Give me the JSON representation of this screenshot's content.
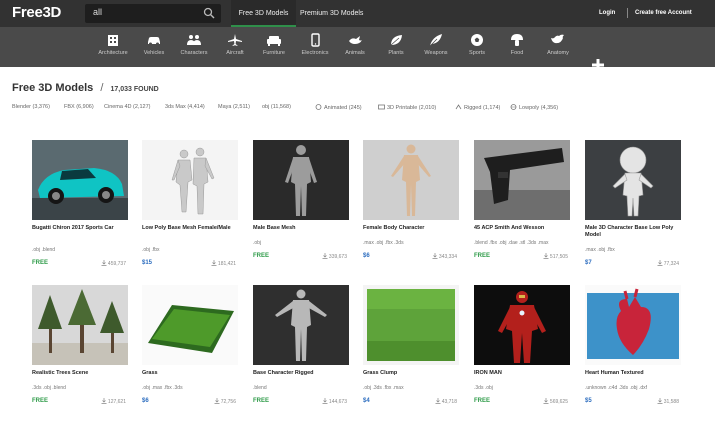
{
  "header": {
    "logo": "Free3D",
    "search_value": "all",
    "tabs": [
      "Free 3D Models",
      "Premium 3D Models"
    ],
    "login": "Login",
    "create_account": "Create free Account"
  },
  "categories": [
    {
      "label": "Architecture",
      "icon": "building-icon"
    },
    {
      "label": "Vehicles",
      "icon": "car-icon"
    },
    {
      "label": "Characters",
      "icon": "people-icon"
    },
    {
      "label": "Aircraft",
      "icon": "airplane-icon"
    },
    {
      "label": "Furniture",
      "icon": "sofa-icon"
    },
    {
      "label": "Electronics",
      "icon": "phone-icon"
    },
    {
      "label": "Animals",
      "icon": "bird-icon"
    },
    {
      "label": "Plants",
      "icon": "leaf-icon"
    },
    {
      "label": "Weapons",
      "icon": "feather-icon"
    },
    {
      "label": "Sports",
      "icon": "soccer-ball-icon"
    },
    {
      "label": "Food",
      "icon": "mushroom-icon"
    },
    {
      "label": "Anatomy",
      "icon": "bird-anatomy-icon"
    }
  ],
  "listing": {
    "title": "Free 3D Models",
    "slash": "/",
    "count": "17,033 FOUND"
  },
  "filters": [
    "Blender (3,376)",
    "FBX (6,906)",
    "Cinema 4D (2,127)",
    "3ds Max (4,414)",
    "Maya (2,511)",
    "obj (11,568)",
    "Animated (245)",
    "3D Printable (2,010)",
    "Rigged (1,174)",
    "Lowpoly (4,356)"
  ],
  "models": [
    {
      "name": "Bugatti Chiron 2017 Sports Car",
      "formats": ".obj .blend",
      "price": "FREE",
      "downloads": "459,737"
    },
    {
      "name": "Low Poly Base Mesh Female/Male",
      "formats": ".obj .fbx",
      "price": "$15",
      "downloads": "181,421"
    },
    {
      "name": "Male Base Mesh",
      "formats": ".obj",
      "price": "FREE",
      "downloads": "339,673"
    },
    {
      "name": "Female Body Character",
      "formats": ".max .obj .fbx .3ds",
      "price": "$6",
      "downloads": "343,334"
    },
    {
      "name": "45 ACP Smith And Wesson",
      "formats": ".blend .fbx .obj .dae .stl .3ds .max",
      "price": "FREE",
      "downloads": "517,505"
    },
    {
      "name": "Male 3D Character Base Low Poly Model",
      "formats": ".max .obj .fbx",
      "price": "$7",
      "downloads": "77,324"
    },
    {
      "name": "Realistic Trees Scene",
      "formats": ".3ds .obj .blend",
      "price": "FREE",
      "downloads": "127,621"
    },
    {
      "name": "Grass",
      "formats": ".obj .max .fbx .3ds",
      "price": "$6",
      "downloads": "72,756"
    },
    {
      "name": "Base Character Rigged",
      "formats": ".blend",
      "price": "FREE",
      "downloads": "144,673"
    },
    {
      "name": "Grass Clump",
      "formats": ".obj .3ds .fbx .max",
      "price": "$4",
      "downloads": "43,718"
    },
    {
      "name": "IRON MAN",
      "formats": ".3ds .obj",
      "price": "FREE",
      "downloads": "569,625"
    },
    {
      "name": "Heart Human Textured",
      "formats": ".unknown .c4d .3ds .obj .dxf",
      "price": "$5",
      "downloads": "31,588"
    }
  ],
  "colors": {
    "topbar": "#323232",
    "catbar": "#4a4a4a",
    "free": "#2e9b48",
    "paid": "#2c6dbf",
    "tab_underline": "#2f8f4a"
  }
}
